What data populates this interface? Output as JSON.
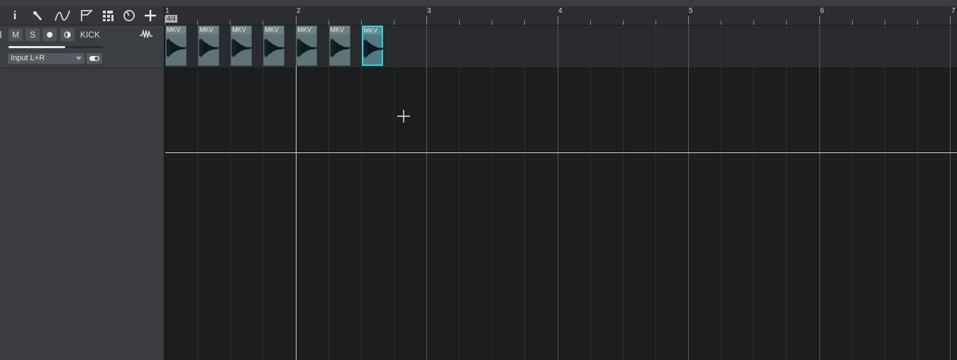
{
  "toolbar": {
    "icons": [
      "info-icon",
      "wrench-icon",
      "automation-curve-icon",
      "marker-flag-icon",
      "grid-layout-icon",
      "tempo-clock-icon",
      "add-track-icon"
    ],
    "info_glyph": "i"
  },
  "ruler": {
    "bars": [
      "1",
      "2",
      "3",
      "4",
      "5",
      "6",
      "7"
    ],
    "time_signature": "4/4"
  },
  "track": {
    "mute_label": "M",
    "solo_label": "S",
    "name": "KICK",
    "input": "Input L+R",
    "volume_fraction": 0.6
  },
  "clips": [
    {
      "label": "MKV"
    },
    {
      "label": "MKV"
    },
    {
      "label": "MKV"
    },
    {
      "label": "MKV"
    },
    {
      "label": "MKV"
    },
    {
      "label": "MKV"
    },
    {
      "label": "MKV",
      "selected": true
    }
  ],
  "colors": {
    "clip": "#5f7478",
    "clip_selected_border": "#2cd3e2",
    "track_header": "#3b3e43",
    "background": "#1c1d1f"
  }
}
